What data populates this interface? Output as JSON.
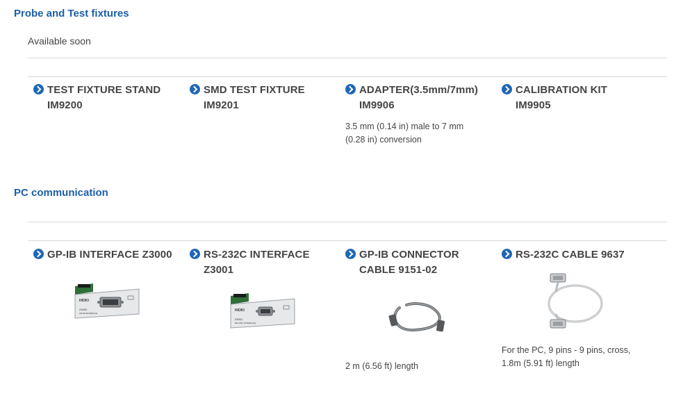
{
  "sections": {
    "probe": {
      "title": "Probe and Test fixtures",
      "note": "Available soon",
      "items": [
        {
          "title": "TEST FIXTURE STAND IM9200",
          "desc": ""
        },
        {
          "title": "SMD TEST FIXTURE IM9201",
          "desc": ""
        },
        {
          "title": "ADAPTER(3.5mm/7mm) IM9906",
          "desc": "3.5 mm (0.14 in) male to 7 mm (0.28 in) conversion"
        },
        {
          "title": "CALIBRATION KIT IM9905",
          "desc": ""
        }
      ]
    },
    "pc": {
      "title": "PC communication",
      "items": [
        {
          "title": "GP-IB INTERFACE Z3000",
          "desc": "",
          "image": "gpib-interface-card-image",
          "brand": "HIOKI",
          "model": "Z3000",
          "label": "GP-IB INTERFACE"
        },
        {
          "title": "RS-232C INTERFACE Z3001",
          "desc": "",
          "image": "rs232c-interface-card-image",
          "brand": "HIOKI",
          "model": "Z3001",
          "label": "RS-232C INTERFACE"
        },
        {
          "title": "GP-IB CONNECTOR CABLE 9151-02",
          "desc": "2 m (6.56 ft) length",
          "image": "gpib-cable-image"
        },
        {
          "title": "RS-232C CABLE 9637",
          "desc": "For the PC, 9 pins - 9 pins, cross, 1.8m (5.91 ft) length",
          "image": "rs232c-cable-image"
        }
      ]
    }
  },
  "colors": {
    "heading": "#1d5fa8",
    "arrow": "#1f66b5",
    "rule": "#d9d9d9",
    "text": "#444444"
  }
}
